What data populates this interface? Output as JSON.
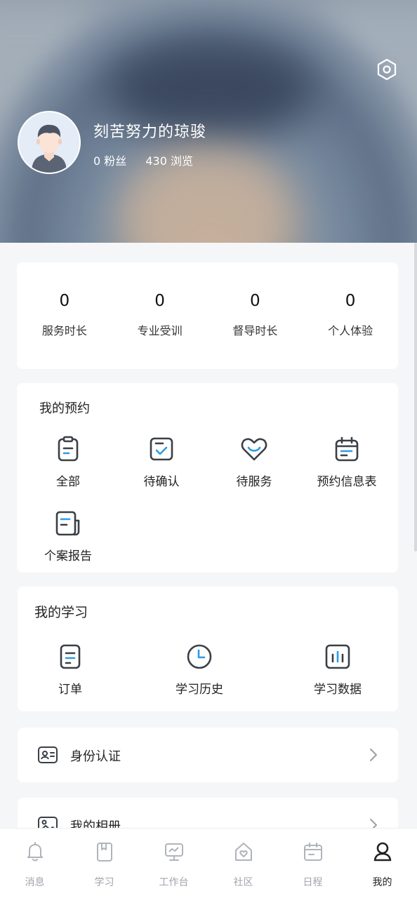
{
  "profile": {
    "nickname": "刻苦努力的琼骏",
    "followers": "0 粉丝",
    "views": "430 浏览"
  },
  "stats": [
    {
      "value": "0",
      "label": "服务时长"
    },
    {
      "value": "0",
      "label": "专业受训"
    },
    {
      "value": "0",
      "label": "督导时长"
    },
    {
      "value": "0",
      "label": "个人体验"
    }
  ],
  "appointments": {
    "title": "我的预约",
    "items": [
      {
        "label": "全部",
        "icon": "clipboard-icon"
      },
      {
        "label": "待确认",
        "icon": "check-square-icon"
      },
      {
        "label": "待服务",
        "icon": "heart-hands-icon"
      },
      {
        "label": "预约信息表",
        "icon": "calendar-icon"
      },
      {
        "label": "个案报告",
        "icon": "report-icon"
      }
    ]
  },
  "learning": {
    "title": "我的学习",
    "items": [
      {
        "label": "订单",
        "icon": "order-icon"
      },
      {
        "label": "学习历史",
        "icon": "clock-icon"
      },
      {
        "label": "学习数据",
        "icon": "bar-chart-icon"
      }
    ]
  },
  "rows": [
    {
      "label": "身份认证",
      "icon": "id-card-icon"
    },
    {
      "label": "我的相册",
      "icon": "album-icon"
    }
  ],
  "tabbar": [
    {
      "label": "消息",
      "icon": "bell-icon"
    },
    {
      "label": "学习",
      "icon": "book-icon"
    },
    {
      "label": "工作台",
      "icon": "monitor-icon"
    },
    {
      "label": "社区",
      "icon": "home-heart-icon"
    },
    {
      "label": "日程",
      "icon": "calendar-icon"
    },
    {
      "label": "我的",
      "icon": "user-icon",
      "active": true
    }
  ],
  "colors": {
    "accent": "#2e9be6",
    "icon_stroke": "#3a3f47",
    "tab_inactive": "#a0a4ab"
  }
}
